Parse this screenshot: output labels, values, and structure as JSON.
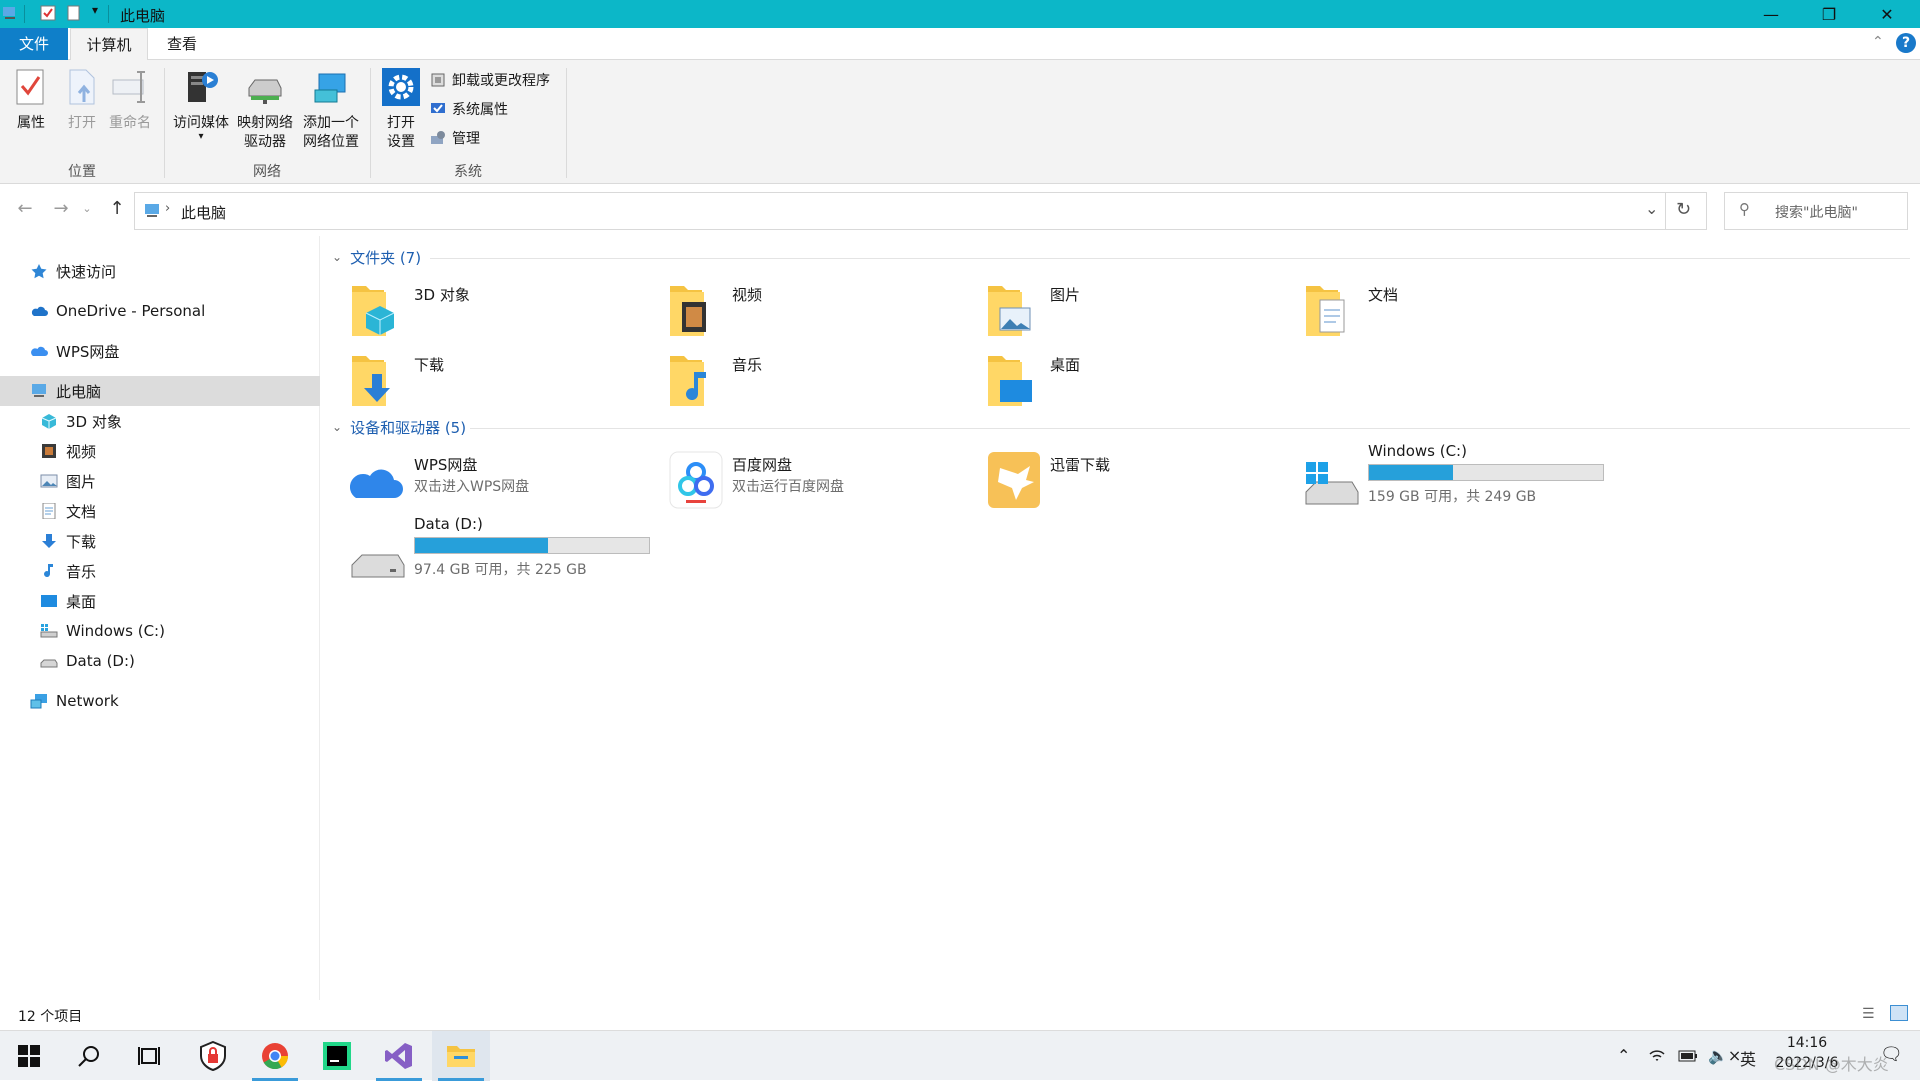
{
  "window": {
    "title": "此电脑"
  },
  "ribbon": {
    "tabs": [
      {
        "label": "文件"
      },
      {
        "label": "计算机"
      },
      {
        "label": "查看"
      }
    ],
    "groups": {
      "location": {
        "label": "位置",
        "properties": "属性",
        "open": "打开",
        "rename": "重命名"
      },
      "network": {
        "label": "网络",
        "access_media": "访问媒体",
        "map_drive_l1": "映射网络",
        "map_drive_l2": "驱动器",
        "add_location_l1": "添加一个",
        "add_location_l2": "网络位置"
      },
      "system": {
        "label": "系统",
        "open_settings_l1": "打开",
        "open_settings_l2": "设置",
        "uninstall": "卸载或更改程序",
        "system_properties": "系统属性",
        "manage": "管理"
      }
    }
  },
  "address": {
    "path": "此电脑",
    "search_placeholder": "搜索\"此电脑\""
  },
  "nav_pane": {
    "quick_access": "快速访问",
    "onedrive": "OneDrive - Personal",
    "wps": "WPS网盘",
    "this_pc": "此电脑",
    "children": [
      "3D 对象",
      "视频",
      "图片",
      "文档",
      "下载",
      "音乐",
      "桌面",
      "Windows (C:)",
      "Data (D:)"
    ],
    "network": "Network"
  },
  "content": {
    "folders_header": "文件夹 (7)",
    "folders": [
      {
        "name": "3D 对象",
        "icon": "folder-3d-icon"
      },
      {
        "name": "视频",
        "icon": "folder-video-icon"
      },
      {
        "name": "图片",
        "icon": "folder-pictures-icon"
      },
      {
        "name": "文档",
        "icon": "folder-documents-icon"
      },
      {
        "name": "下载",
        "icon": "folder-downloads-icon"
      },
      {
        "name": "音乐",
        "icon": "folder-music-icon"
      },
      {
        "name": "桌面",
        "icon": "folder-desktop-icon"
      }
    ],
    "devices_header": "设备和驱动器 (5)",
    "devices": [
      {
        "name": "WPS网盘",
        "sub": "双击进入WPS网盘"
      },
      {
        "name": "百度网盘",
        "sub": "双击运行百度网盘"
      },
      {
        "name": "迅雷下载",
        "sub": ""
      },
      {
        "name": "Windows (C:)",
        "sub": "159 GB 可用，共 249 GB",
        "used_fraction": 0.36
      },
      {
        "name": "Data (D:)",
        "sub": "97.4 GB 可用，共 225 GB",
        "used_fraction": 0.57
      }
    ]
  },
  "status": {
    "item_count": "12 个项目"
  },
  "taskbar": {
    "ime": "英",
    "time": "14:16",
    "date": "2022/3/6",
    "watermark": "CSDN @木大炎"
  },
  "colors": {
    "titlebar": "#0cb7c8",
    "file_tab": "#0f7fc9",
    "accent": "#26a0da",
    "link": "#1e5fb0"
  }
}
